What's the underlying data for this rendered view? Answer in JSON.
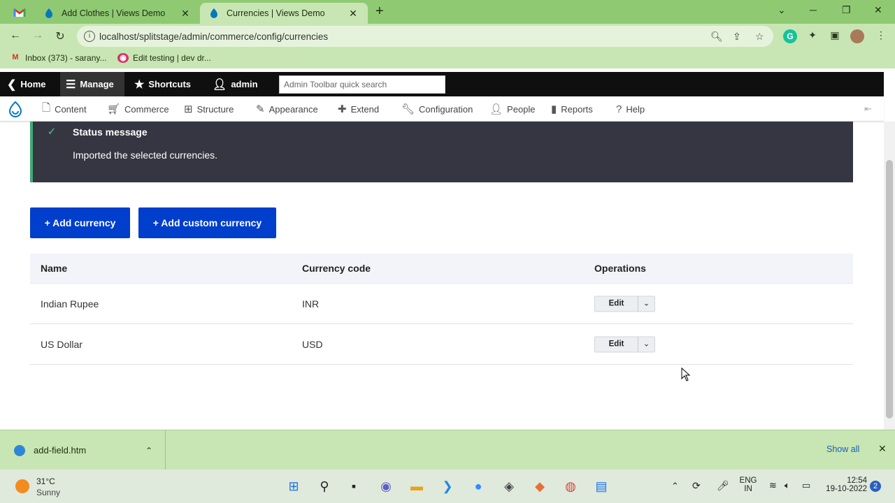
{
  "browser": {
    "tabs": [
      {
        "title": "Add Clothes | Views Demo",
        "active": false
      },
      {
        "title": "Currencies | Views Demo",
        "active": true
      }
    ],
    "url": "localhost/splitstage/admin/commerce/config/currencies",
    "bookmarks": [
      {
        "label": "Inbox (373) - sarany...",
        "icon": "gmail-icon"
      },
      {
        "label": "Edit testing | dev dr...",
        "icon": "extension-icon"
      }
    ]
  },
  "toolbar": {
    "home": "Home",
    "manage": "Manage",
    "shortcuts": "Shortcuts",
    "user": "admin",
    "search_placeholder": "Admin Toolbar quick search"
  },
  "menu": {
    "items": [
      "Content",
      "Commerce",
      "Structure",
      "Appearance",
      "Extend",
      "Configuration",
      "People",
      "Reports",
      "Help"
    ]
  },
  "status": {
    "title": "Status message",
    "message": "Imported the selected currencies."
  },
  "actions": {
    "add_currency": "+ Add currency",
    "add_custom_currency": "+ Add custom currency"
  },
  "table": {
    "headers": [
      "Name",
      "Currency code",
      "Operations"
    ],
    "rows": [
      {
        "name": "Indian Rupee",
        "code": "INR",
        "op": "Edit"
      },
      {
        "name": "US Dollar",
        "code": "USD",
        "op": "Edit"
      }
    ]
  },
  "downloads": {
    "file": "add-field.htm",
    "show_all": "Show all"
  },
  "taskbar": {
    "temp": "31°C",
    "weather": "Sunny",
    "lang1": "ENG",
    "lang2": "IN",
    "time": "12:54",
    "date": "19-10-2022",
    "notifications": "2"
  },
  "colors": {
    "primary": "#003ecc",
    "status_bg": "#353641",
    "status_accent": "#42a877",
    "browser_frame": "#8fca73"
  }
}
